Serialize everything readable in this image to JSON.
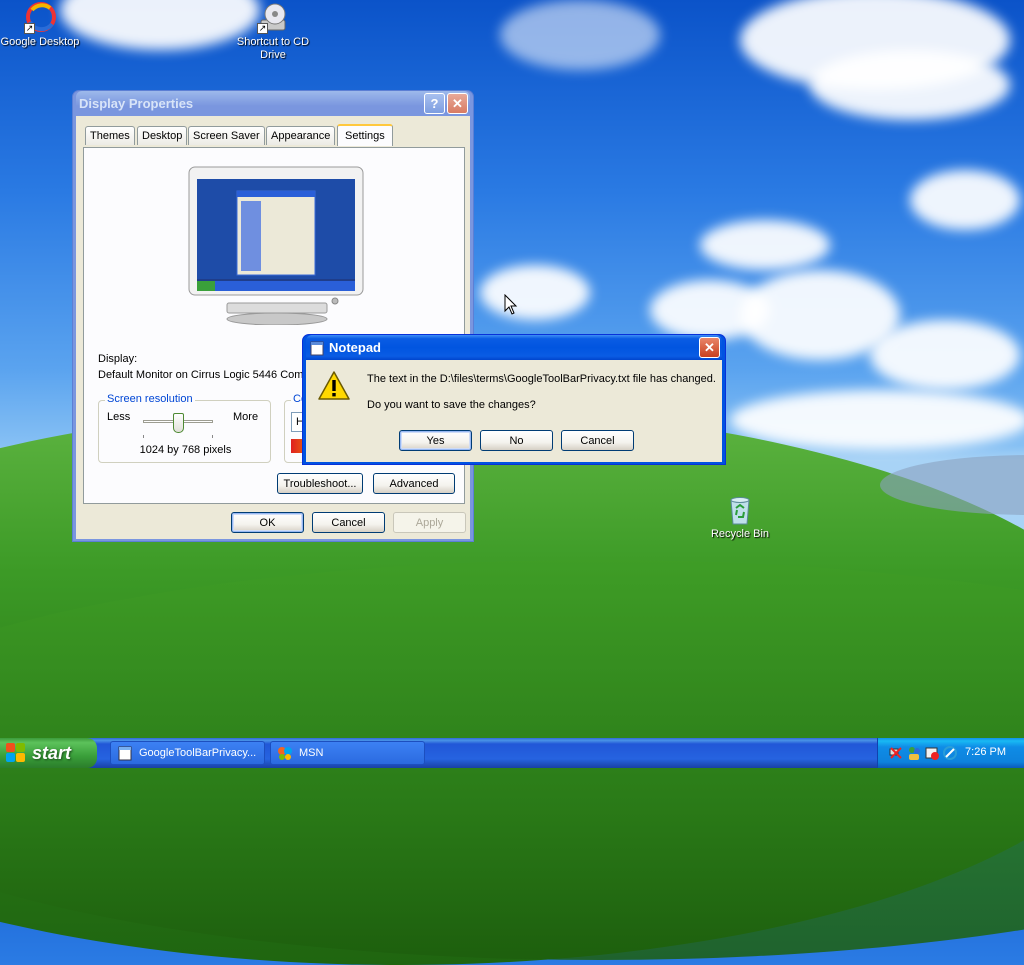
{
  "desktop": {
    "icons": [
      {
        "label": "Google Desktop"
      },
      {
        "label": "Shortcut to CD Drive"
      },
      {
        "label": "Recycle Bin"
      }
    ]
  },
  "display_properties": {
    "title": "Display Properties",
    "tabs": [
      "Themes",
      "Desktop",
      "Screen Saver",
      "Appearance",
      "Settings"
    ],
    "selected_tab": "Settings",
    "display_label": "Display:",
    "display_value": "Default Monitor on Cirrus Logic 5446 Compa",
    "resolution_group": "Screen resolution",
    "less_label": "Less",
    "more_label": "More",
    "resolution_value": "1024 by 768 pixels",
    "slider_fraction": 0.5,
    "color_group": "Co",
    "color_value": "Hi",
    "troubleshoot_label": "Troubleshoot...",
    "advanced_label": "Advanced",
    "ok_label": "OK",
    "cancel_label": "Cancel",
    "apply_label": "Apply"
  },
  "notepad_dialog": {
    "title": "Notepad",
    "message": "The text in the D:\\files\\terms\\GoogleToolBarPrivacy.txt file has changed.",
    "question": "Do you want to save the changes?",
    "yes_label": "Yes",
    "no_label": "No",
    "cancel_label": "Cancel"
  },
  "taskbar": {
    "start_label": "start",
    "items": [
      {
        "label": "GoogleToolBarPrivacy..."
      },
      {
        "label": "MSN"
      }
    ],
    "clock": "7:26 PM"
  },
  "colors": {
    "xp_blue": "#0053e1",
    "start_green": "#3a9f3a",
    "dialog_bg": "#ece9d8"
  }
}
